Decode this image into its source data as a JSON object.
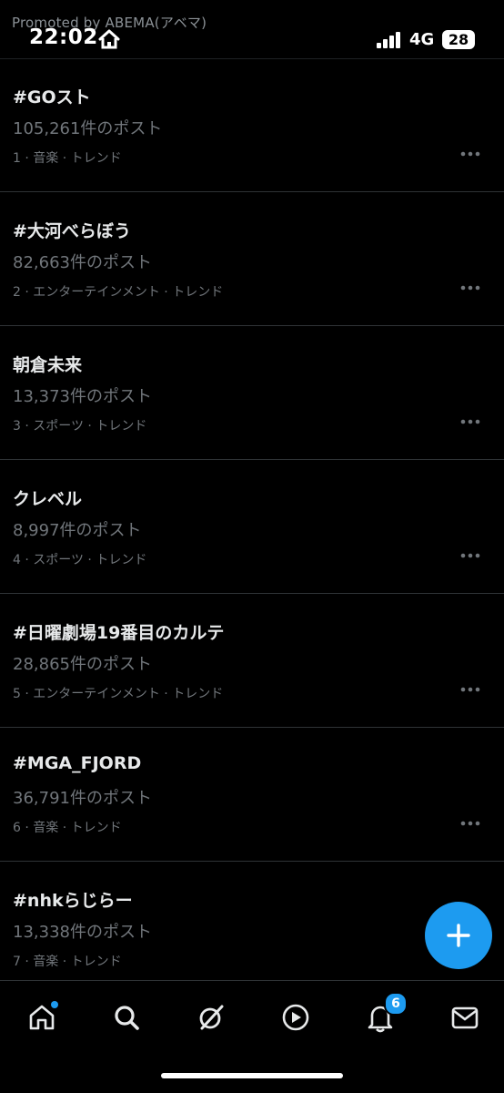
{
  "status_bar": {
    "promoted": "Promoted by ABEMA(アベマ)",
    "time": "22:02",
    "network": "4G",
    "battery": "28"
  },
  "trends": [
    {
      "title": "#GOスト",
      "count": "105,261件のポスト",
      "meta": "1 · 音楽 · トレンド"
    },
    {
      "title": "#大河べらぼう",
      "count": "82,663件のポスト",
      "meta": "2 · エンターテインメント · トレンド"
    },
    {
      "title": "朝倉未来",
      "count": "13,373件のポスト",
      "meta": "3 · スポーツ · トレンド"
    },
    {
      "title": "クレベル",
      "count": "8,997件のポスト",
      "meta": "4 · スポーツ · トレンド"
    },
    {
      "title": "#日曜劇場19番目のカルテ",
      "count": "28,865件のポスト",
      "meta": "5 · エンターテインメント · トレンド"
    },
    {
      "title": "#MGA_FJORD",
      "count": "36,791件のポスト",
      "meta": "6 · 音楽 · トレンド"
    },
    {
      "title": "#nhkらじらー",
      "count": "13,338件のポスト",
      "meta": "7 · 音楽 · トレンド"
    }
  ],
  "fab": {
    "icon": "plus-icon"
  },
  "bottom_nav": {
    "items": [
      "home-icon",
      "search-icon",
      "grok-icon",
      "video-icon",
      "notifications-icon",
      "messages-icon"
    ],
    "notifications_badge": "6"
  },
  "colors": {
    "accent": "#1d9bf0",
    "background": "#000000",
    "secondary_text": "#71767b"
  }
}
